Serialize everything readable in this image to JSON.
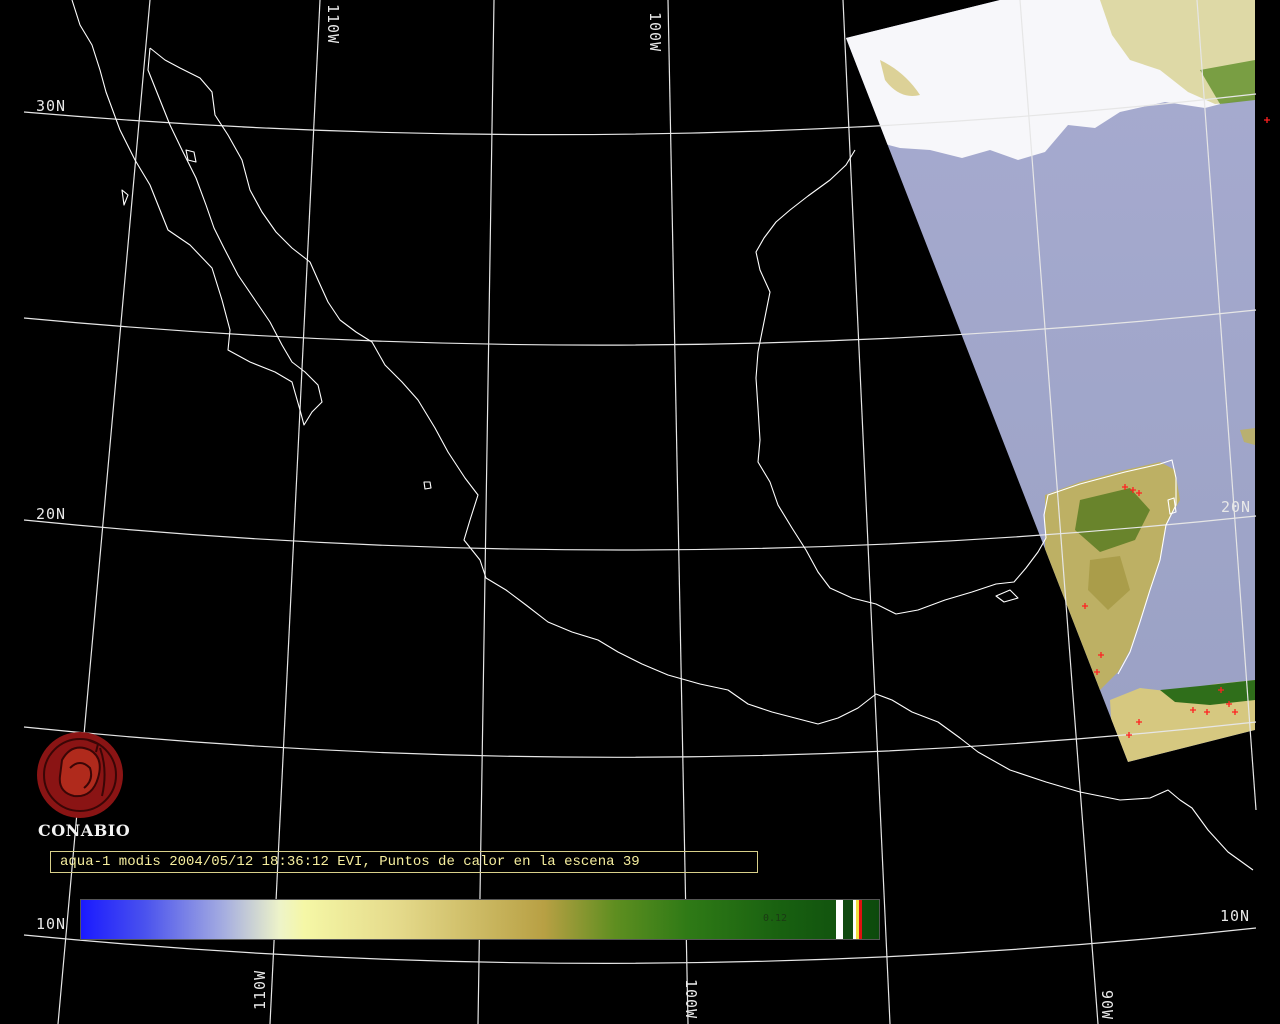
{
  "map": {
    "organization": "CONABIO",
    "caption": "aqua-1 modis 2004/05/12 18:36:12 EVI, Puntos de calor en la escena 39",
    "colorbar_tick_label": "0.12",
    "latitude_labels": {
      "lat30_left": "30N",
      "lat20_left": "20N",
      "lat20_right": "20N",
      "lat10_left": "10N",
      "lat10_right": "10N"
    },
    "longitude_labels": {
      "lon110_top": "110W",
      "lon100_top": "100W",
      "lon110_bottom": "110W",
      "lon100_bottom": "100W",
      "lon90_bottom": "90W"
    },
    "colors": {
      "graticule": "#e6e6e6",
      "coastline": "#ffffff",
      "hotspot": "#ff2020",
      "caption_text": "#f6ee9e",
      "ocean_swath": "#9ea3c8",
      "cloud": "#f8f8fa",
      "vegetation_dry": "#c2b866",
      "vegetation_green": "#3c7a1e"
    }
  }
}
